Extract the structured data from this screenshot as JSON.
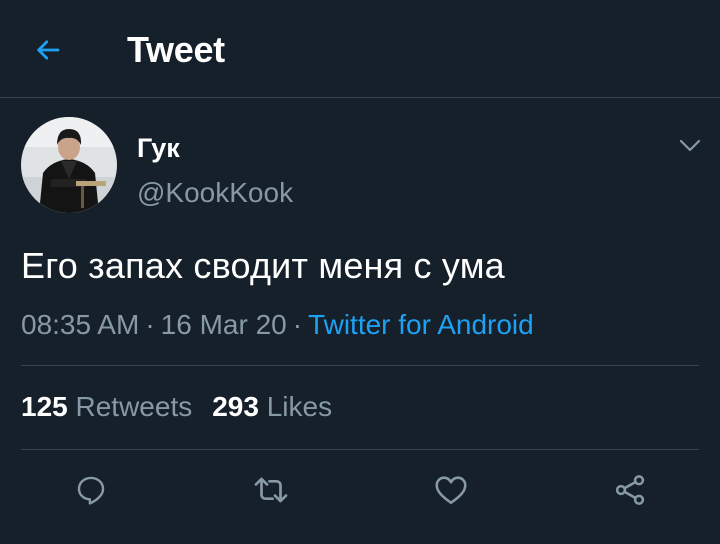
{
  "header": {
    "back_icon": "arrow-left-icon",
    "title": "Tweet"
  },
  "tweet": {
    "author": {
      "name": "Гук",
      "handle": "@KookKook",
      "avatar": "user-avatar-photo"
    },
    "text": "Его запах сводит меня с ума",
    "time": "08:35 AM",
    "date": "16 Mar 20",
    "separator": "·",
    "source": "Twitter for Android",
    "stats": {
      "retweets_count": "125",
      "retweets_label": "Retweets",
      "likes_count": "293",
      "likes_label": "Likes"
    }
  },
  "actions": [
    "reply-icon",
    "retweet-icon",
    "like-icon",
    "share-icon"
  ],
  "colors": {
    "background": "#15202b",
    "accent": "#1da1f2",
    "secondary_text": "#8899a6",
    "divider": "#38444d"
  }
}
